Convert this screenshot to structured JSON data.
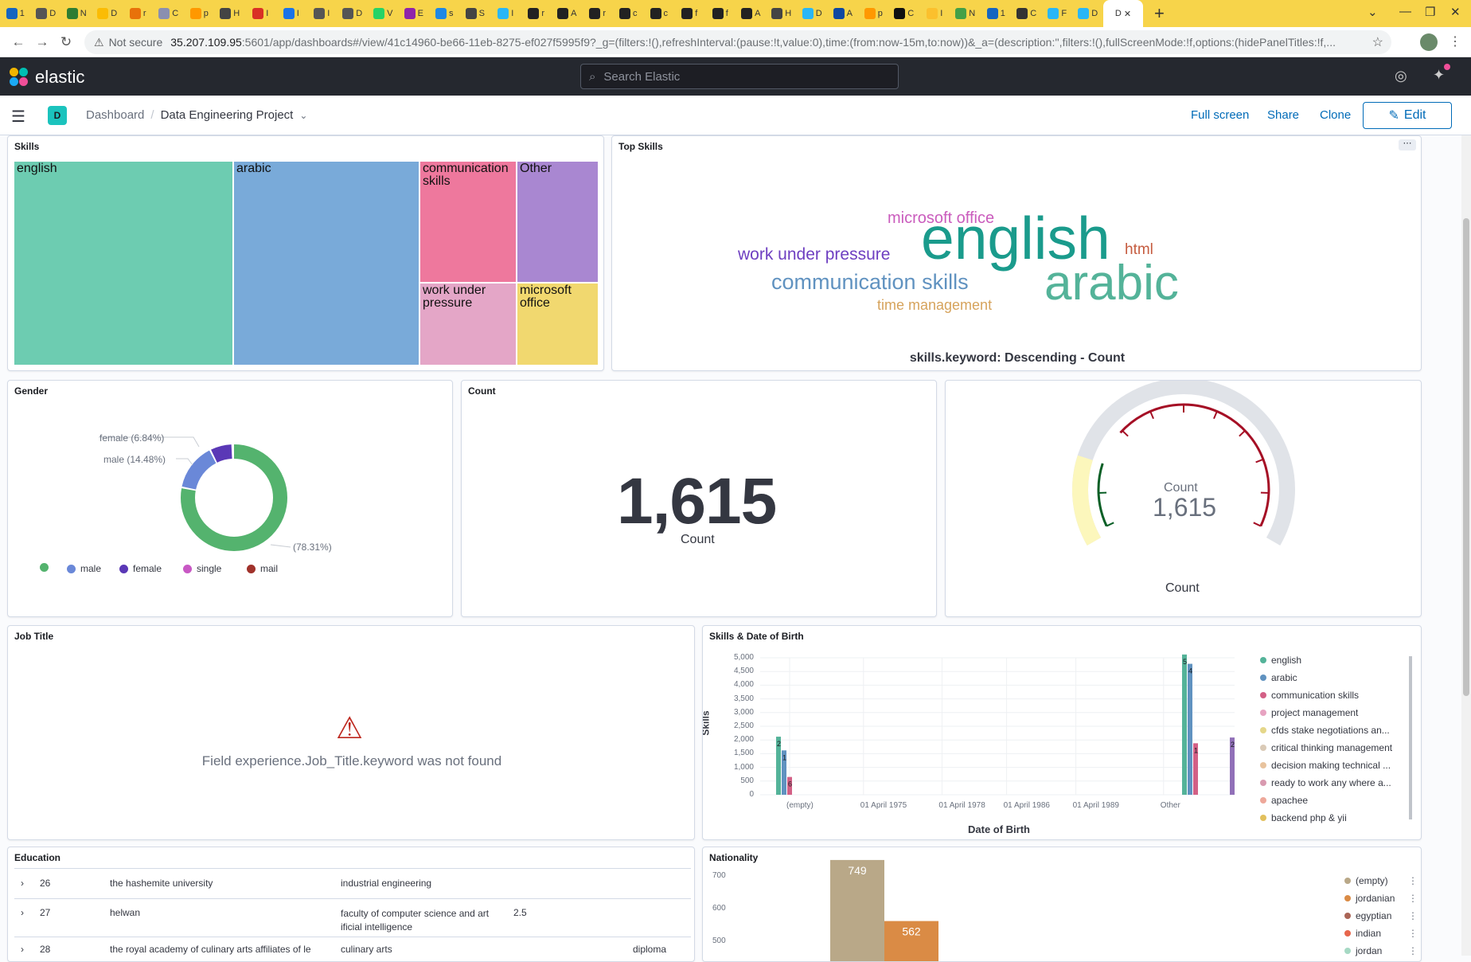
{
  "browser": {
    "tabs": [
      {
        "color": "#1565c0",
        "label": "1"
      },
      {
        "color": "#555555",
        "label": "D"
      },
      {
        "color": "#2e7d32",
        "label": "N"
      },
      {
        "color": "#fbbc04",
        "label": "D"
      },
      {
        "color": "#e8710a",
        "label": "r"
      },
      {
        "color": "#8a8fb0",
        "label": "C"
      },
      {
        "color": "#ff9800",
        "label": "p"
      },
      {
        "color": "#444444",
        "label": "H"
      },
      {
        "color": "#d93025",
        "label": "I"
      },
      {
        "color": "#1a73e8",
        "label": "I"
      },
      {
        "color": "#555555",
        "label": "I"
      },
      {
        "color": "#555555",
        "label": "D"
      },
      {
        "color": "#25d366",
        "label": "V"
      },
      {
        "color": "#8e24aa",
        "label": "E"
      },
      {
        "color": "#1e88e5",
        "label": "s"
      },
      {
        "color": "#444444",
        "label": "S"
      },
      {
        "color": "#29b6f6",
        "label": "I"
      },
      {
        "color": "#222222",
        "label": "r"
      },
      {
        "color": "#222222",
        "label": "A"
      },
      {
        "color": "#222222",
        "label": "r"
      },
      {
        "color": "#222222",
        "label": "c"
      },
      {
        "color": "#222222",
        "label": "c"
      },
      {
        "color": "#222222",
        "label": "f"
      },
      {
        "color": "#222222",
        "label": "f"
      },
      {
        "color": "#222222",
        "label": "A"
      },
      {
        "color": "#444444",
        "label": "H"
      },
      {
        "color": "#29b6f6",
        "label": "D"
      },
      {
        "color": "#0d47a1",
        "label": "A"
      },
      {
        "color": "#ff9800",
        "label": "p"
      },
      {
        "color": "#111111",
        "label": "C"
      },
      {
        "color": "#fbc02d",
        "label": "I"
      },
      {
        "color": "#43a047",
        "label": "N"
      },
      {
        "color": "#1565c0",
        "label": "1"
      },
      {
        "color": "#333333",
        "label": "C"
      },
      {
        "color": "#29b6f6",
        "label": "F"
      },
      {
        "color": "#29b6f6",
        "label": "D"
      }
    ],
    "active_tab_label": "D",
    "back_icon": "←",
    "forward_icon": "→",
    "reload_icon": "↻",
    "security_icon": "⚠",
    "security_label": "Not secure",
    "url_host": "35.207.109.95",
    "url_path": ":5601/app/dashboards#/view/41c14960-be66-11eb-8275-ef027f5995f9?_g=(filters:!(),refreshInterval:(pause:!t,value:0),time:(from:now-15m,to:now))&_a=(description:'',filters:!(),fullScreenMode:!f,options:(hidePanelTitles:!f,..."
  },
  "kibana": {
    "logo_text": "elastic",
    "search_placeholder": "Search Elastic",
    "space_initial": "D",
    "breadcrumb_root": "Dashboard",
    "breadcrumb_current": "Data Engineering Project",
    "actions": {
      "full_screen": "Full screen",
      "share": "Share",
      "clone": "Clone",
      "edit": "Edit"
    }
  },
  "panels": {
    "skills": {
      "title": "Skills",
      "cells": [
        {
          "label": "english",
          "color": "#6dccb1"
        },
        {
          "label": "arabic",
          "color": "#79aad9"
        },
        {
          "label": "communication skills",
          "color": "#ee789d"
        },
        {
          "label": "Other",
          "color": "#a987d1"
        },
        {
          "label": "work under pressure",
          "color": "#e4a6c7"
        },
        {
          "label": "microsoft office",
          "color": "#f1d86f"
        }
      ]
    },
    "top_skills": {
      "title": "Top Skills",
      "menu_icon": "⋯",
      "caption": "skills.keyword: Descending - Count",
      "words": [
        {
          "text": "english",
          "color": "#1a9b8c"
        },
        {
          "text": "arabic",
          "color": "#54b399"
        },
        {
          "text": "microsoft office",
          "color": "#ca5cbd"
        },
        {
          "text": "work under pressure",
          "color": "#6e3fc1"
        },
        {
          "text": "html",
          "color": "#c55b3f"
        },
        {
          "text": "communication skills",
          "color": "#6092c0"
        },
        {
          "text": "time management",
          "color": "#d6a35c"
        }
      ]
    },
    "gender": {
      "title": "Gender",
      "chart_data": {
        "type": "pie",
        "slices": [
          {
            "label": "",
            "percent": 78.31,
            "color": "#54b36e"
          },
          {
            "label": "male",
            "percent": 14.48,
            "color": "#6a88d8"
          },
          {
            "label": "female",
            "percent": 6.84,
            "color": "#5a38b6"
          }
        ],
        "callouts": [
          "female (6.84%)",
          "male (14.48%)",
          "(78.31%)"
        ],
        "legend": [
          {
            "label": "",
            "color": "#54b36e"
          },
          {
            "label": "male",
            "color": "#6a88d8"
          },
          {
            "label": "female",
            "color": "#5a38b6"
          },
          {
            "label": "single",
            "color": "#c858c4"
          },
          {
            "label": "mail",
            "color": "#a0322b"
          }
        ]
      }
    },
    "count": {
      "title": "Count",
      "value": "1,615",
      "label": "Count"
    },
    "gauge": {
      "value": "1,615",
      "label": "Count",
      "inner_label": "Count",
      "fill_fraction": 0.2
    },
    "job_title": {
      "title": "Job Title",
      "warning_icon": "⚠",
      "error": "Field experience.Job_Title.keyword was not found"
    },
    "skills_dob": {
      "title": "Skills & Date of Birth",
      "chart_data": {
        "type": "bar",
        "ylabel": "Skills",
        "xlabel": "Date of Birth",
        "ylim": [
          0,
          5000
        ],
        "yticks": [
          "5,000",
          "4,500",
          "4,000",
          "3,500",
          "3,000",
          "2,500",
          "2,000",
          "1,500",
          "1,000",
          "500",
          "0"
        ],
        "x_tick_labels": [
          "(empty)",
          "01 April 1975",
          "01 April 1978",
          "01 April 1986",
          "01 April 1989",
          "Other"
        ],
        "groups": [
          {
            "x": "(empty)",
            "bars": [
              {
                "series": "english",
                "value": 2120,
                "label": "2",
                "color": "#54b399"
              },
              {
                "series": "arabic",
                "value": 1620,
                "label": "1",
                "color": "#6092c0"
              },
              {
                "series": "communication skills",
                "value": 650,
                "label": "6",
                "color": "#d36086"
              }
            ]
          },
          {
            "x": "Other",
            "bars": [
              {
                "series": "english",
                "value": 5120,
                "label": "5",
                "color": "#54b399"
              },
              {
                "series": "arabic",
                "value": 4780,
                "label": "4",
                "color": "#6092c0"
              },
              {
                "series": "communication skills",
                "value": 1880,
                "label": "1",
                "color": "#d36086"
              },
              {
                "series": "other",
                "value": 2090,
                "label": "2",
                "color": "#9170b8"
              }
            ]
          }
        ],
        "legend": [
          {
            "label": "english",
            "color": "#54b399"
          },
          {
            "label": "arabic",
            "color": "#6092c0"
          },
          {
            "label": "communication skills",
            "color": "#d36086"
          },
          {
            "label": "project management",
            "color": "#e7a3c1"
          },
          {
            "label": "cfds stake negotiations an...",
            "color": "#e5d78a"
          },
          {
            "label": "critical thinking management",
            "color": "#dacab7"
          },
          {
            "label": "decision making technical ...",
            "color": "#e8c39e"
          },
          {
            "label": "ready to work any where a...",
            "color": "#d99ab0"
          },
          {
            "label": "apachee",
            "color": "#eea89a"
          },
          {
            "label": "backend php & yii",
            "color": "#e2c05d"
          }
        ]
      }
    },
    "education": {
      "title": "Education",
      "rows": [
        {
          "id": "26",
          "university": "the hashemite university",
          "faculty": "industrial engineering",
          "gpa": "",
          "degree": ""
        },
        {
          "id": "27",
          "university": "helwan",
          "faculty": "faculty of computer science and art ificial intelligence",
          "gpa": "2.5",
          "degree": ""
        },
        {
          "id": "28",
          "university": "the royal academy of culinary arts affiliates of le",
          "faculty": "culinary arts",
          "gpa": "",
          "degree": "diploma"
        }
      ]
    },
    "nationality": {
      "title": "Nationality",
      "chart_data": {
        "type": "bar",
        "yticks": [
          "700",
          "600",
          "500"
        ],
        "bars": [
          {
            "label": "(empty)",
            "value": 749,
            "color": "#b9a888"
          },
          {
            "label": "jordanian",
            "value": 562,
            "color": "#da8b45"
          }
        ],
        "legend": [
          {
            "label": "(empty)",
            "color": "#b9a888"
          },
          {
            "label": "jordanian",
            "color": "#da8b45"
          },
          {
            "label": "egyptian",
            "color": "#aa6556"
          },
          {
            "label": "indian",
            "color": "#e7664c"
          },
          {
            "label": "jordan",
            "color": "#a6d9c4"
          }
        ]
      }
    }
  }
}
